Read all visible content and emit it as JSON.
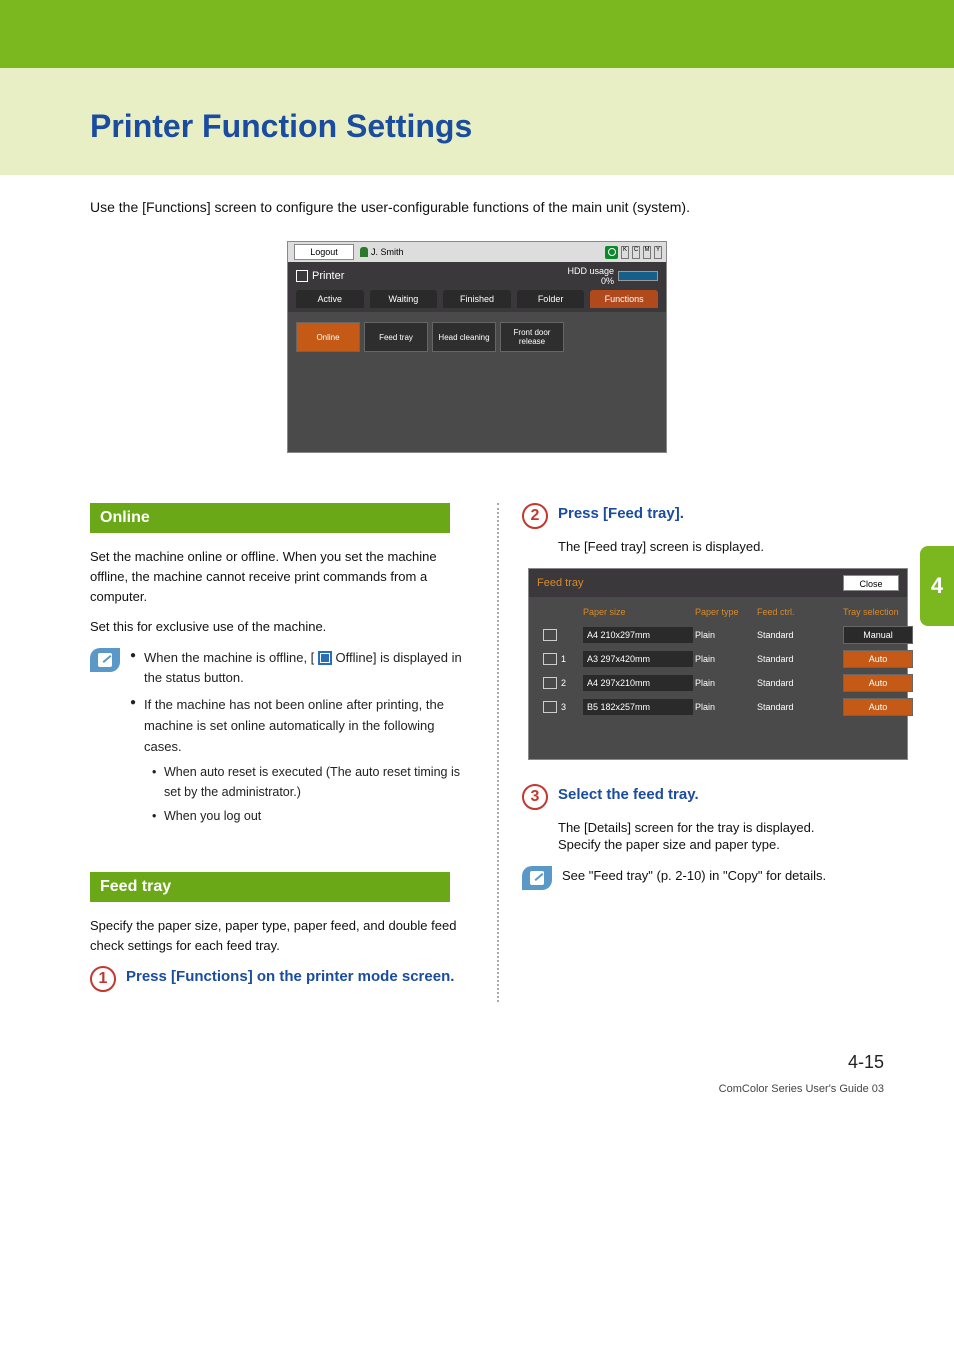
{
  "page": {
    "title": "Printer Function Settings",
    "intro": "Use the [Functions] screen to configure the user-configurable functions of the main unit (system).",
    "page_number": "4-15",
    "footer_line": "ComColor Series User's Guide 03",
    "side_tab": "4"
  },
  "shot1": {
    "logout": "Logout",
    "user": "J. Smith",
    "printer_label": "Printer",
    "hdd_label": "HDD usage",
    "hdd_pct": "0%",
    "tabs": [
      "Active",
      "Waiting",
      "Finished",
      "Folder",
      "Functions"
    ],
    "buttons": [
      "Online",
      "Feed tray",
      "Head cleaning",
      "Front door release"
    ],
    "ink_letters": [
      "K",
      "C",
      "M",
      "Y"
    ]
  },
  "online": {
    "heading": "Online",
    "p1": "Set the machine online or offline. When you set the machine offline, the machine cannot receive print commands from a computer.",
    "p2": "Set this for exclusive use of the machine.",
    "b1a": "When the machine is offline, [ ",
    "b1b": " Offline] is displayed in the status button.",
    "b2": "If the machine has not been online after printing, the machine is set online automatically in the following cases.",
    "sb1": "When auto reset is executed (The auto reset timing is set by the administrator.)",
    "sb2": "When you log out"
  },
  "feedtray": {
    "heading": "Feed tray",
    "p1": "Specify the paper size, paper type, paper feed, and double feed check settings for each feed tray."
  },
  "step1": {
    "num": "1",
    "title": "Press [Functions] on the printer mode screen."
  },
  "step2": {
    "num": "2",
    "title": "Press [Feed tray].",
    "desc": "The [Feed tray] screen is displayed."
  },
  "step3": {
    "num": "3",
    "title": "Select the feed tray.",
    "desc1": "The [Details] screen for the tray is displayed.",
    "desc2": "Specify the paper size and paper type."
  },
  "crossref": "See \"Feed tray\" (p. 2-10) in \"Copy\" for details.",
  "shot2": {
    "title": "Feed tray",
    "close": "Close",
    "headers": {
      "size": "Paper size",
      "type": "Paper type",
      "ctrl": "Feed ctrl.",
      "sel": "Tray selection"
    }
  },
  "chart_data": {
    "type": "table",
    "title": "Feed tray",
    "columns": [
      "Tray",
      "Paper size",
      "Paper type",
      "Feed ctrl.",
      "Tray selection"
    ],
    "rows": [
      {
        "tray": "",
        "size": "A4 210x297mm",
        "type": "Plain",
        "ctrl": "Standard",
        "sel": "Manual"
      },
      {
        "tray": "1",
        "size": "A3 297x420mm",
        "type": "Plain",
        "ctrl": "Standard",
        "sel": "Auto"
      },
      {
        "tray": "2",
        "size": "A4 297x210mm",
        "type": "Plain",
        "ctrl": "Standard",
        "sel": "Auto"
      },
      {
        "tray": "3",
        "size": "B5 182x257mm",
        "type": "Plain",
        "ctrl": "Standard",
        "sel": "Auto"
      }
    ]
  }
}
